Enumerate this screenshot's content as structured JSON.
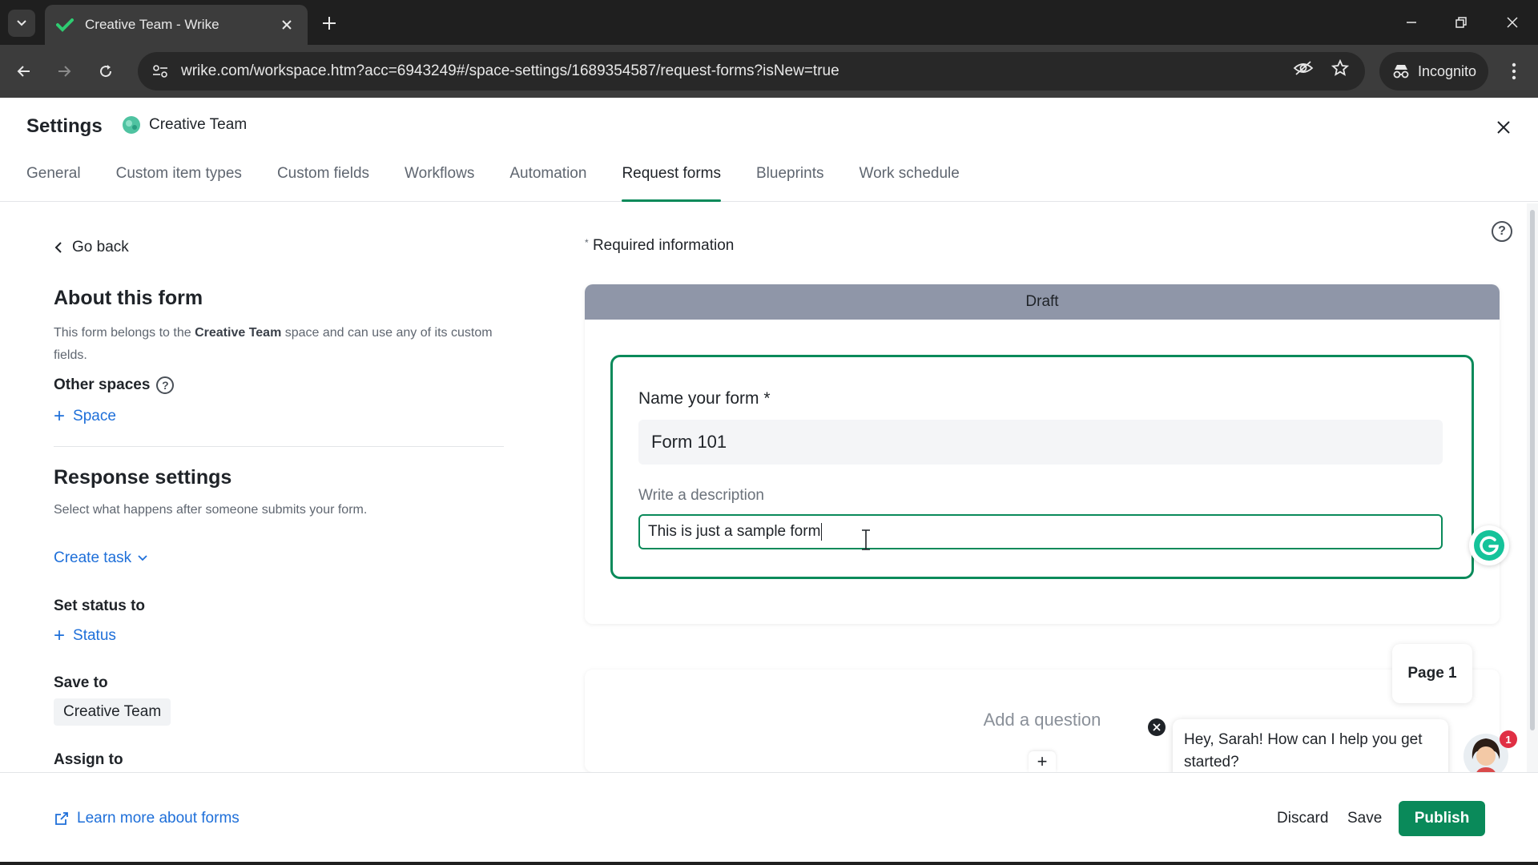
{
  "browser": {
    "tab_title": "Creative Team - Wrike",
    "url": "wrike.com/workspace.htm?acc=6943249#/space-settings/1689354587/request-forms?isNew=true",
    "incognito_label": "Incognito"
  },
  "header": {
    "title": "Settings",
    "space_name": "Creative Team",
    "tabs": [
      {
        "label": "General"
      },
      {
        "label": "Custom item types"
      },
      {
        "label": "Custom fields"
      },
      {
        "label": "Workflows"
      },
      {
        "label": "Automation"
      },
      {
        "label": "Request forms",
        "active": true
      },
      {
        "label": "Blueprints"
      },
      {
        "label": "Work schedule"
      }
    ]
  },
  "left": {
    "go_back": "Go back",
    "about_title": "About this form",
    "about_desc_1": "This form belongs to the ",
    "about_desc_space": "Creative Team",
    "about_desc_2": " space and can use any of its custom fields.",
    "other_spaces": "Other spaces",
    "add_space": "Space",
    "response_title": "Response settings",
    "response_desc": "Select what happens after someone submits your form.",
    "create_task": "Create task",
    "set_status_to": "Set status to",
    "add_status": "Status",
    "save_to": "Save to",
    "save_to_value": "Creative Team",
    "assign_to": "Assign to"
  },
  "form": {
    "required_marker": "*",
    "required_info": "Required information",
    "status_banner": "Draft",
    "name_label": "Name your form *",
    "name_value": "Form 101",
    "desc_label": "Write a description",
    "desc_value": "This is just a sample form",
    "add_question": "Add a question",
    "add_question_plus": "+",
    "page_label": "Page 1"
  },
  "chat": {
    "message": "Hey, Sarah! How can I help you get started?",
    "badge_count": "1"
  },
  "footer": {
    "learn_more": "Learn more about forms",
    "discard": "Discard",
    "save": "Save",
    "publish": "Publish"
  },
  "colors": {
    "accent_green": "#0a8a5a",
    "link_blue": "#1e6fd9",
    "draft_banner": "#8f96a8"
  }
}
